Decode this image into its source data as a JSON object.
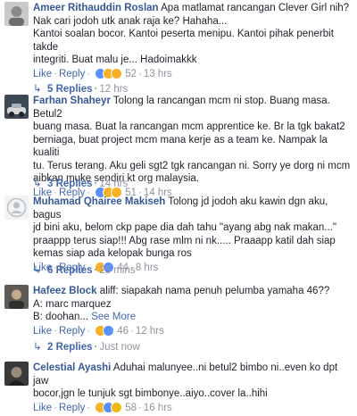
{
  "comments": [
    {
      "name": "Ameer Rithauddin Roslan",
      "text_lines": [
        "Apa matlamat rancangan Clever Girl nih?",
        "Nak cari jodoh utk anak raja ke? Hahaha...",
        "Kantoi soalan bocor. Kantoi peserta menipu. Kantoi pihak penerbit takde",
        "integriti. Buat malu je... Hadoimakkk"
      ],
      "like": "Like",
      "reply": "Reply",
      "reactions": [
        "like-icon",
        "haha-icon",
        "wow-icon"
      ],
      "count": "52",
      "time": "13 hrs",
      "replies": "5 Replies",
      "replies_time": "12 hrs"
    },
    {
      "name": "Farhan Shaheyr",
      "text_lines": [
        "Tolong la rancangan mcm ni stop. Buang masa. Betul2",
        "buang masa. Buat la rancangan mcm apprentice ke. Br la tgk bakat2",
        "berniaga, buat project mcm mana kerje as a team ke. Nampak la kualiti",
        "tu. Terus terang. Aku geli sgt2 tgk rancangan ni. Sorry ye dorg ni mcm",
        "aibkan muke sendiri kt org malaysia."
      ],
      "like": "Like",
      "reply": "Reply",
      "reactions": [
        "like-icon",
        "haha-icon",
        "wow-icon"
      ],
      "count": "51",
      "time": "14 hrs",
      "replies": "3 Replies",
      "replies_time": "14 hrs"
    },
    {
      "name": "Muhamad Qhairee Makiseh",
      "text_lines": [
        "Tolong jd jodoh aku kawin dgn aku, bagus",
        "jd bini aku, belom ckp pape dia dah tahu \"ayang abg nak makan...\"",
        "praappp terus siap!!! Abg rase mlm ni nk..... Praaapp katil dah siap",
        "kemas siap ada kelopak bunga ros"
      ],
      "like": "Like",
      "reply": "Reply",
      "reactions": [
        "haha-icon",
        "like-icon"
      ],
      "count": "44",
      "time": "8 hrs",
      "replies": "6 Replies",
      "replies_time": "25 mins"
    },
    {
      "name": "Hafeez Block",
      "text_lines": [
        "aliff: siapakah nama penuh pelumba yamaha 46??",
        "A: marc marquez",
        "B: doohan..."
      ],
      "see_more": "See More",
      "like": "Like",
      "reply": "Reply",
      "reactions": [
        "haha-icon",
        "like-icon"
      ],
      "count": "46",
      "time": "12 hrs",
      "replies": "2 Replies",
      "replies_time": "Just now"
    },
    {
      "name": "Celestial Ayashi",
      "text_lines": [
        "Aduhai malunyee..ni betul2 bimbo ni..even ko dpt jaw",
        "bocor,jgn le tunjuk sgt bimbonye..aiyo..cover la..hihi"
      ],
      "like": "Like",
      "reply": "Reply",
      "reactions": [
        "haha-icon",
        "like-icon",
        "sad-icon"
      ],
      "count": "58",
      "time": "16 hrs"
    }
  ],
  "separator": "·",
  "reply_arrow": "↳"
}
